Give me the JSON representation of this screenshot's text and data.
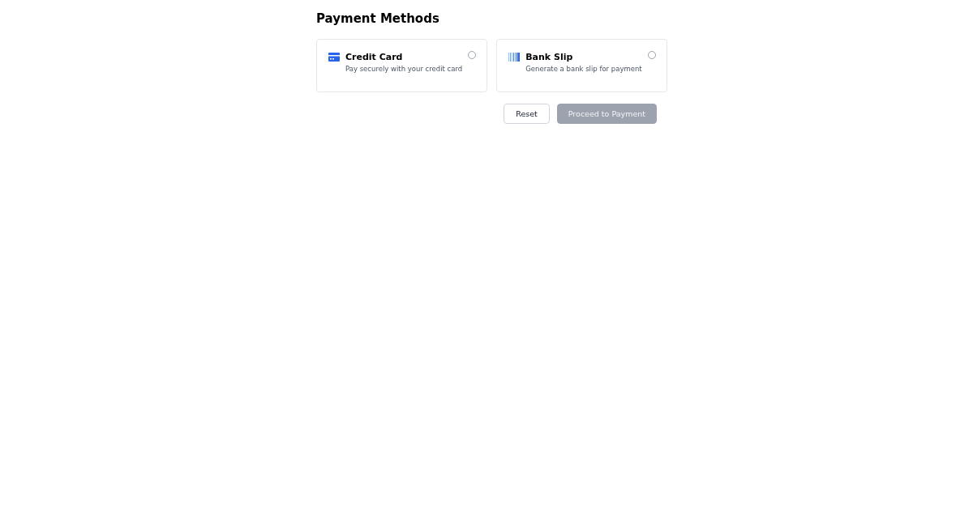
{
  "title": "Payment Methods",
  "methods": [
    {
      "kind": "card",
      "title": "Credit Card",
      "description": "Pay securely with your credit card",
      "selected": false
    },
    {
      "kind": "slip",
      "title": "Bank Slip",
      "description": "Generate a bank slip for payment",
      "selected": false
    }
  ],
  "buttons": [
    {
      "kind": "reset",
      "label": "Reset",
      "disabled": false
    },
    {
      "kind": "proceed",
      "label": "Proceed to Payment",
      "disabled": true
    }
  ]
}
